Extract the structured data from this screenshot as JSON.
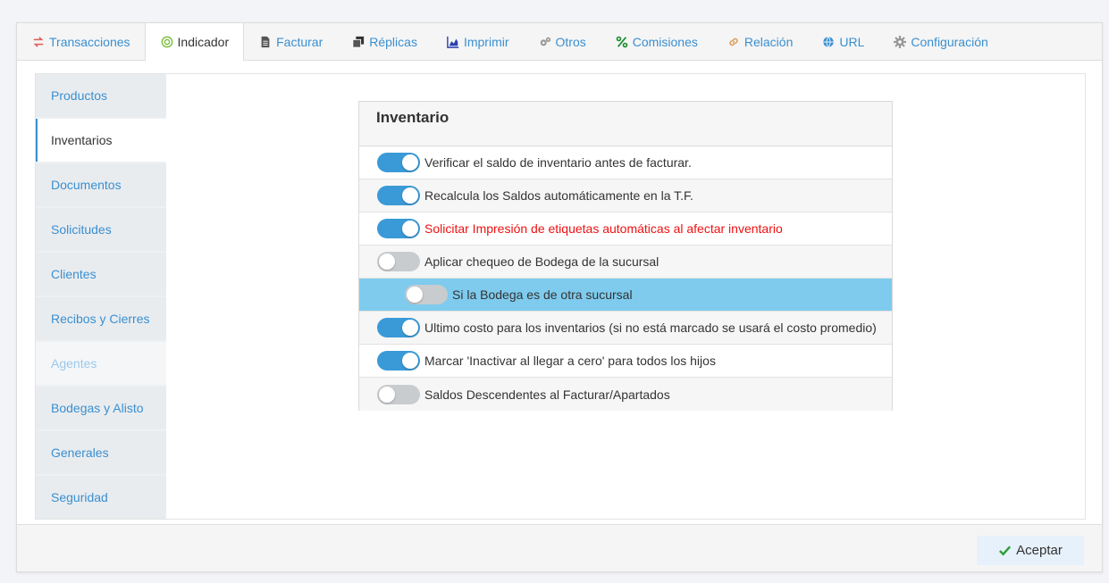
{
  "tabs": [
    {
      "label": "Transacciones",
      "icon": "exchange-icon",
      "color": "#e05a5a"
    },
    {
      "label": "Indicador",
      "icon": "target-icon",
      "color": "#7bbf3a",
      "active": true
    },
    {
      "label": "Facturar",
      "icon": "document-icon",
      "color": "#555555"
    },
    {
      "label": "Réplicas",
      "icon": "copy-icon",
      "color": "#333333"
    },
    {
      "label": "Imprimir",
      "icon": "area-chart-icon",
      "color": "#2a3fb0"
    },
    {
      "label": "Otros",
      "icon": "cogs-icon",
      "color": "#999999"
    },
    {
      "label": "Comisiones",
      "icon": "percent-icon",
      "color": "#1a8a2a"
    },
    {
      "label": "Relación",
      "icon": "link-icon",
      "color": "#e0a060"
    },
    {
      "label": "URL",
      "icon": "globe-icon",
      "color": "#3a8fd0"
    },
    {
      "label": "Configuración",
      "icon": "gear-icon",
      "color": "#999999"
    }
  ],
  "sidebar": {
    "items": [
      {
        "label": "Productos"
      },
      {
        "label": "Inventarios",
        "active": true
      },
      {
        "label": "Documentos"
      },
      {
        "label": "Solicitudes"
      },
      {
        "label": "Clientes"
      },
      {
        "label": "Recibos y Cierres"
      },
      {
        "label": "Agentes",
        "disabled": true
      },
      {
        "label": "Bodegas y Alisto"
      },
      {
        "label": "Generales"
      },
      {
        "label": "Seguridad"
      }
    ]
  },
  "panel": {
    "title": "Inventario",
    "rows": [
      {
        "label": "Verificar el saldo de inventario antes de facturar.",
        "on": true
      },
      {
        "label": "Recalcula los Saldos automáticamente en la T.F.",
        "on": true
      },
      {
        "label": "Solicitar Impresión de etiquetas automáticas al afectar inventario",
        "on": true,
        "red": true
      },
      {
        "label": "Aplicar chequeo de Bodega de la sucursal",
        "on": false
      },
      {
        "label": "Si la Bodega es de otra sucursal",
        "on": false,
        "highlight": true
      },
      {
        "label": "Ultimo costo para los inventarios (si no está marcado se usará el costo promedio)",
        "on": true
      },
      {
        "label": "Marcar 'Inactivar al llegar a cero' para todos los hijos",
        "on": true
      },
      {
        "label": "Saldos Descendentes al Facturar/Apartados",
        "on": false
      }
    ]
  },
  "footer": {
    "accept_label": "Aceptar",
    "accept_icon": "check-icon",
    "accept_icon_color": "#2e9e3a"
  },
  "colors": {
    "accent": "#3a9ad7",
    "link": "#3a8fd0",
    "highlight_row": "#7ecbee",
    "warning_text": "#e11111"
  }
}
